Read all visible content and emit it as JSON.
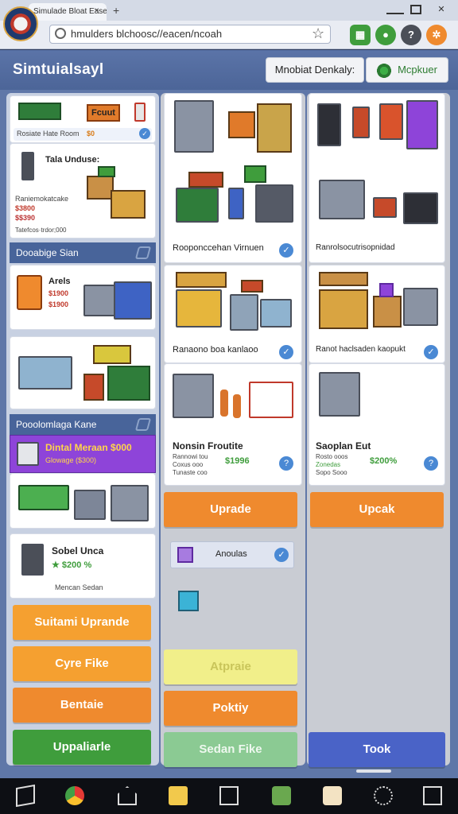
{
  "browser": {
    "tab_title": "Simulade Bloat Ease",
    "url": "hmulders blchoosc//eacen/ncoah",
    "tab_close": "×",
    "new_tab": "+"
  },
  "header": {
    "title": "Simtuialsayl",
    "button_left": "Mnobiat Denkaly:",
    "button_right": "Mcpkuer"
  },
  "left": {
    "top_card": {
      "banner": "Fcuut",
      "tagline": "Rosiate Hate Room",
      "tag_price": "$0"
    },
    "item1": {
      "title": "Tala Unduse:",
      "desc": "Raniemokatcake",
      "price1": "$3800",
      "price2": "$$390",
      "note": "Tatefcos·trdor;000"
    },
    "section1": "Dooabige Sian",
    "item2": {
      "title": "Arels",
      "price1": "$1900",
      "price2": "$1900"
    },
    "section2": "Pooolomlaga Kane",
    "promo": "Dintal Meraan $000",
    "promo_sub": "Glowage ($300)",
    "item3": {
      "title": "Sobel Unca",
      "price": "$200 %",
      "footer": "Mencan Sedan"
    }
  },
  "mid": {
    "label1": "Rooponccehan Virnuen",
    "label2": "Ranaono boa kanlaoo",
    "item": {
      "title": "Nonsin Froutite",
      "stats": [
        "Rannowi tou",
        "Coxus ooo",
        "Tunaste coo"
      ],
      "price": "$1996"
    },
    "upgrade": "Uprade",
    "small_card": "Anoulas"
  },
  "right": {
    "label1": "Ranrolsocutrisopnidad",
    "label2": "Ranot haclsaden kaopukt",
    "item": {
      "title": "Saoplan Eut",
      "stats": [
        "Rosto ooos",
        "Zonedas",
        "Sopo Sooo"
      ],
      "price": "$200%"
    },
    "upgrade": "Upcak"
  },
  "bottom_buttons": {
    "left": [
      "Suitami Uprande",
      "Cyre Fike",
      "Bentaie",
      "Uppaliarle"
    ],
    "mid": [
      "Atpraie",
      "Poktiy",
      "Sedan Fike"
    ],
    "right": [
      "Took"
    ]
  },
  "colors": {
    "orange": "#ef8a2e",
    "orange_light": "#f5a030",
    "green": "#3f9d3c",
    "green_light": "#8bca93",
    "yellow": "#f1ef8a",
    "blue": "#4a63c7"
  }
}
